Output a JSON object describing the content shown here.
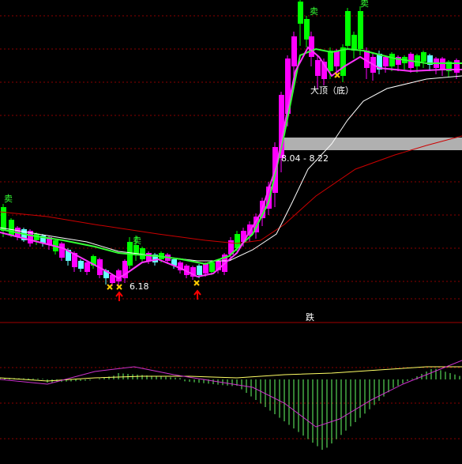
{
  "colors": {
    "background": "#000000",
    "grid": "#8b0000",
    "divider": "#a00000",
    "candle_up": "#ff00ff",
    "candle_down": "#00ff00",
    "candle_neutral": "#66ffff",
    "ma_green": "#33ff33",
    "ma_magenta": "#ff33ff",
    "ma_white": "#ffffff",
    "ma_red": "#cc0000",
    "zone": "#b0b0b0",
    "macd_diff": "#ffff66",
    "macd_dea": "#cc33cc",
    "macd_hist": "#66ff66",
    "buy_arrow": "#ff0000",
    "sell_text": "#33ff33",
    "cross_mark": "#ffcc00"
  },
  "labels": {
    "low_price": "6.18",
    "zone_range": "8.04 - 8.22",
    "top_note": "大顶（底）",
    "sell_tag": "卖",
    "divider_tag": "跌"
  },
  "icons": [
    "buy-arrow-icon",
    "cross-mark-icon"
  ]
}
